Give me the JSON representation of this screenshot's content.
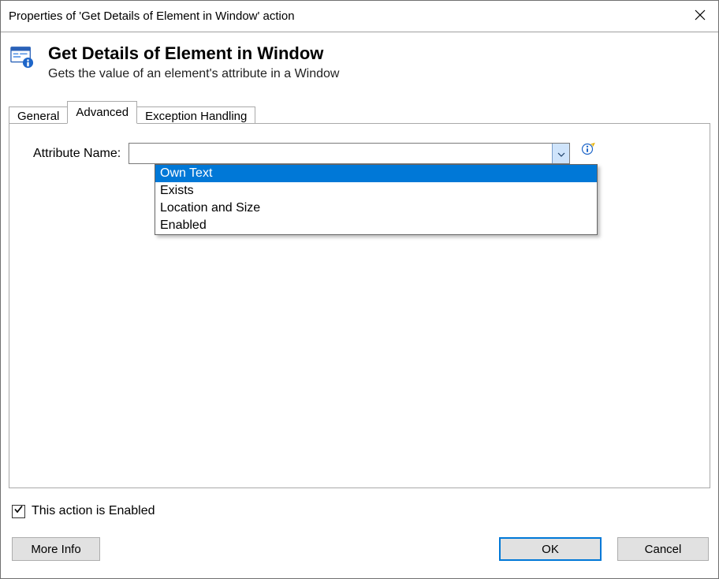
{
  "titlebar": {
    "text": "Properties of 'Get Details of Element in Window' action"
  },
  "header": {
    "title": "Get Details of Element in Window",
    "subtitle": "Gets the value of an element's attribute in a Window"
  },
  "tabs": {
    "general": "General",
    "advanced": "Advanced",
    "exception": "Exception Handling",
    "active": "advanced"
  },
  "form": {
    "attribute_label": "Attribute Name:",
    "combo_value": "",
    "options": {
      "0": "Own Text",
      "1": "Exists",
      "2": "Location and Size",
      "3": "Enabled"
    },
    "selected_index": 0
  },
  "footer": {
    "enabled_label": "This action is Enabled",
    "enabled_checked": true,
    "more_info": "More Info",
    "ok": "OK",
    "cancel": "Cancel"
  }
}
